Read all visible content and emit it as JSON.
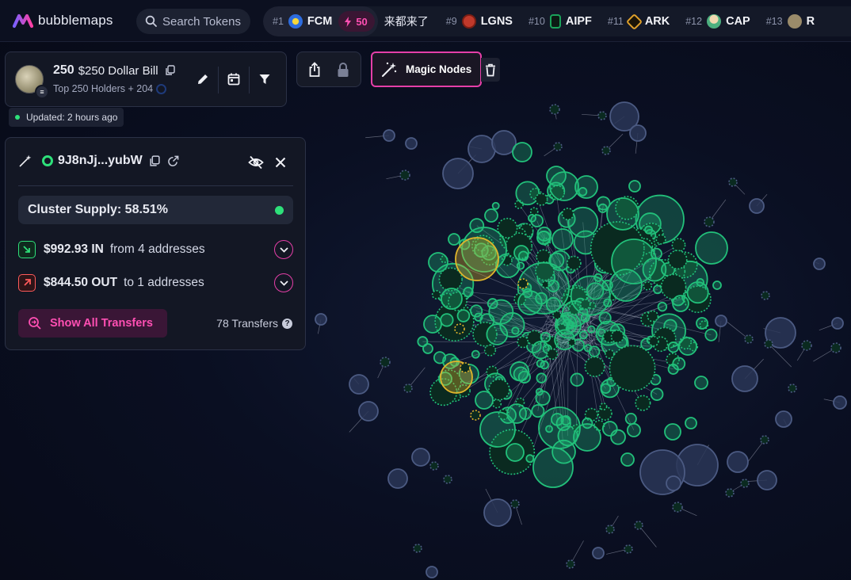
{
  "app": {
    "name": "bubblemaps",
    "brand_color": "#e53fa8"
  },
  "search": {
    "placeholder": "Search Tokens"
  },
  "ticker": [
    {
      "rank": "#1",
      "symbol": "FCM",
      "boost": "50",
      "icon_color": "#2d6cdf"
    },
    {
      "rank": "",
      "symbol": "来都来了",
      "icon_color": ""
    },
    {
      "rank": "#9",
      "symbol": "LGNS",
      "icon_color": "#c0392b"
    },
    {
      "rank": "#10",
      "symbol": "AIPF",
      "icon_color": "#1aa35a"
    },
    {
      "rank": "#11",
      "symbol": "ARK",
      "icon_color": "#e0a12b"
    },
    {
      "rank": "#12",
      "symbol": "CAP",
      "icon_color": "#4caf7f"
    },
    {
      "rank": "#13",
      "symbol": "R",
      "icon_color": "#9a8b6a"
    }
  ],
  "token": {
    "ticker": "250",
    "name": "$250 Dollar Bill",
    "subtitle": "Top 250 Holders + 204"
  },
  "status": {
    "updated": "Updated: 2 hours ago"
  },
  "toolbar": {
    "magic_nodes_label": "Magic Nodes"
  },
  "wallet": {
    "address": "9J8nJj...yubW",
    "cluster_supply": "Cluster Supply: 58.51%",
    "inflow": {
      "amount": "$992.93 IN",
      "detail": "from 4 addresses"
    },
    "outflow": {
      "amount": "$844.50 OUT",
      "detail": "to 1 addresses"
    },
    "show_all_label": "Show All Transfers",
    "transfers_count": "78 Transfers"
  },
  "colors": {
    "cluster_green": "#22c07a",
    "highlight_yellow": "#e0b52b",
    "inactive_blue": "#2a3657",
    "in_icon": "#2ee07a",
    "out_icon": "#ff5a5a"
  }
}
